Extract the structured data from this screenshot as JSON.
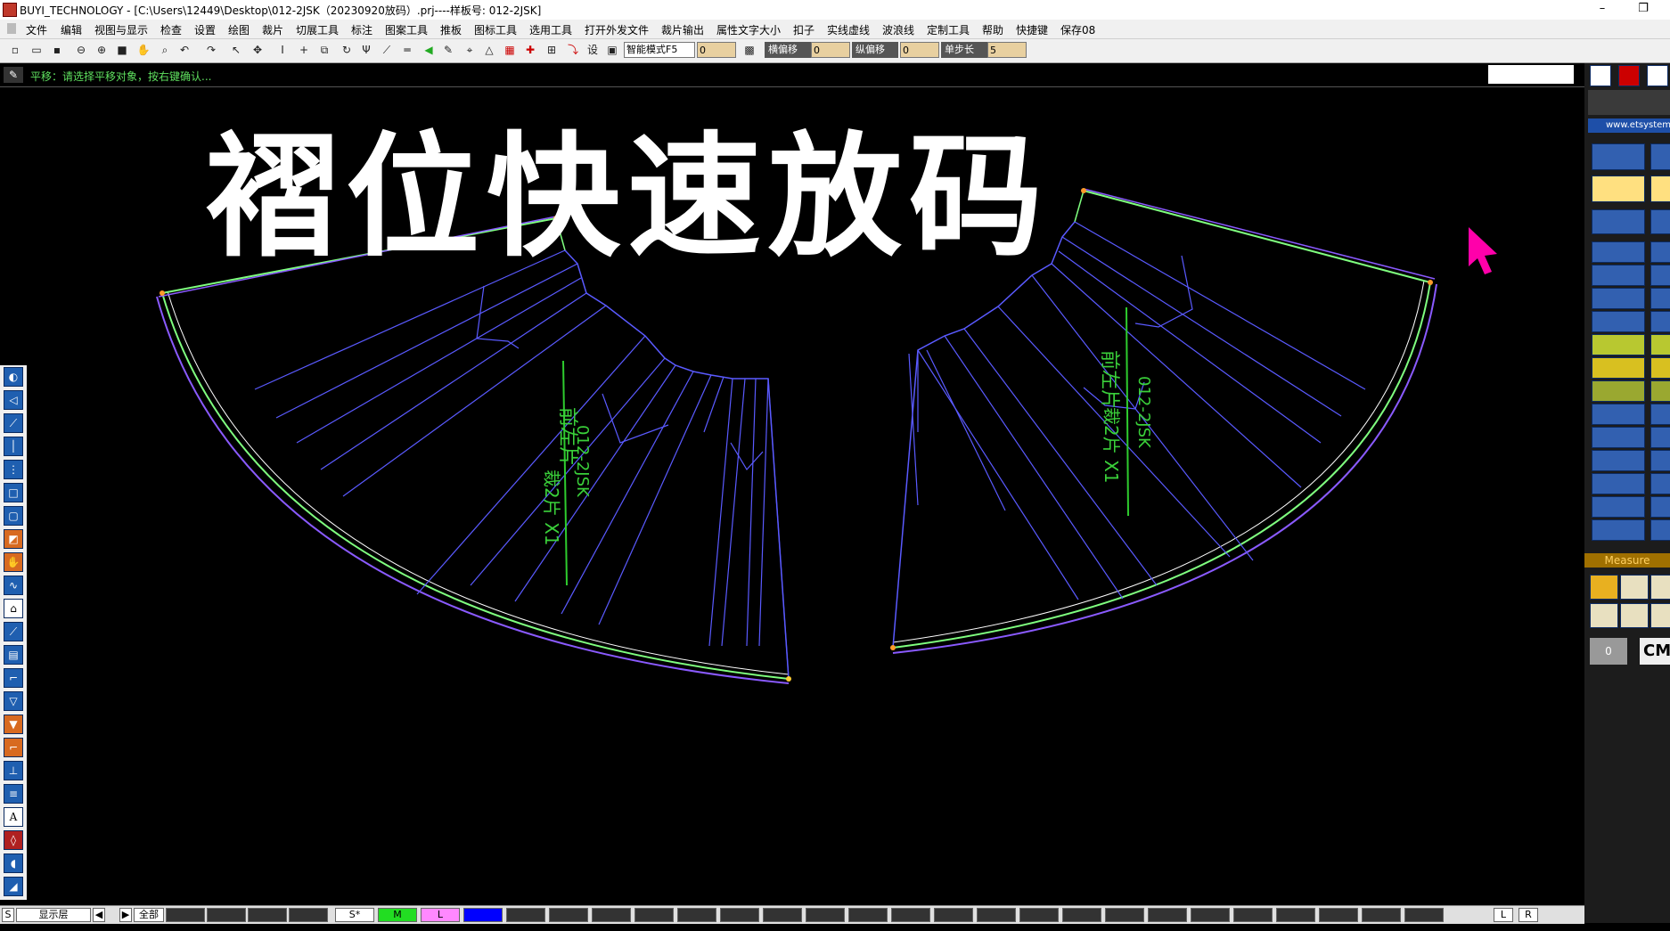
{
  "window": {
    "title": "BUYI_TECHNOLOGY - [C:\\Users\\12449\\Desktop\\012-2JSK（20230920放码）.prj----样板号: 012-2JSK]",
    "minimize": "–",
    "restore": "❐"
  },
  "menu": [
    "文件",
    "编辑",
    "视图与显示",
    "检查",
    "设置",
    "绘图",
    "裁片",
    "切展工具",
    "标注",
    "图案工具",
    "推板",
    "图标工具",
    "选用工具",
    "打开外发文件",
    "裁片输出",
    "属性文字大小",
    "扣子",
    "实线虚线",
    "波浪线",
    "定制工具",
    "帮助",
    "快捷键",
    "保存08"
  ],
  "toolbar": {
    "mode_select": "智能模式F5",
    "field1_value": "0",
    "h_offset_label": "横偏移",
    "h_offset_value": "0",
    "v_offset_label": "纵偏移",
    "v_offset_value": "0",
    "step_label": "单步长",
    "step_value": "5"
  },
  "status": {
    "text": "平移：请选择平移对象，按右键确认..."
  },
  "overlay": {
    "title": "褶位快速放码"
  },
  "pieces": {
    "left_label_vertical1": "前左片",
    "left_label_vertical2": "012-2JSK",
    "left_label_vertical3": "裁2片 X1",
    "right_label_vertical1": "前左片",
    "right_label_vertical2": "012-2JSK",
    "right_label_vertical3": "裁2片 X1"
  },
  "right_panel": {
    "url": "www.etsystem",
    "measure_label": "Measure",
    "zero_label": "0",
    "unit": "CM"
  },
  "bottom": {
    "s_label": "S",
    "layer_label": "显示层",
    "prev": "◀",
    "next": "▶",
    "all_label": "全部",
    "size_s": "S*",
    "size_m": "M",
    "size_l": "L",
    "l_btn": "L",
    "r_btn": "R"
  },
  "colors": {
    "size_s": "#ffffff",
    "size_m": "#22dd22",
    "size_l": "#ff88ff",
    "size_xl": "#0000ff",
    "pattern_line": "#5a5aff",
    "seam_green": "#7fff7f",
    "cursor": "#ff00aa"
  }
}
